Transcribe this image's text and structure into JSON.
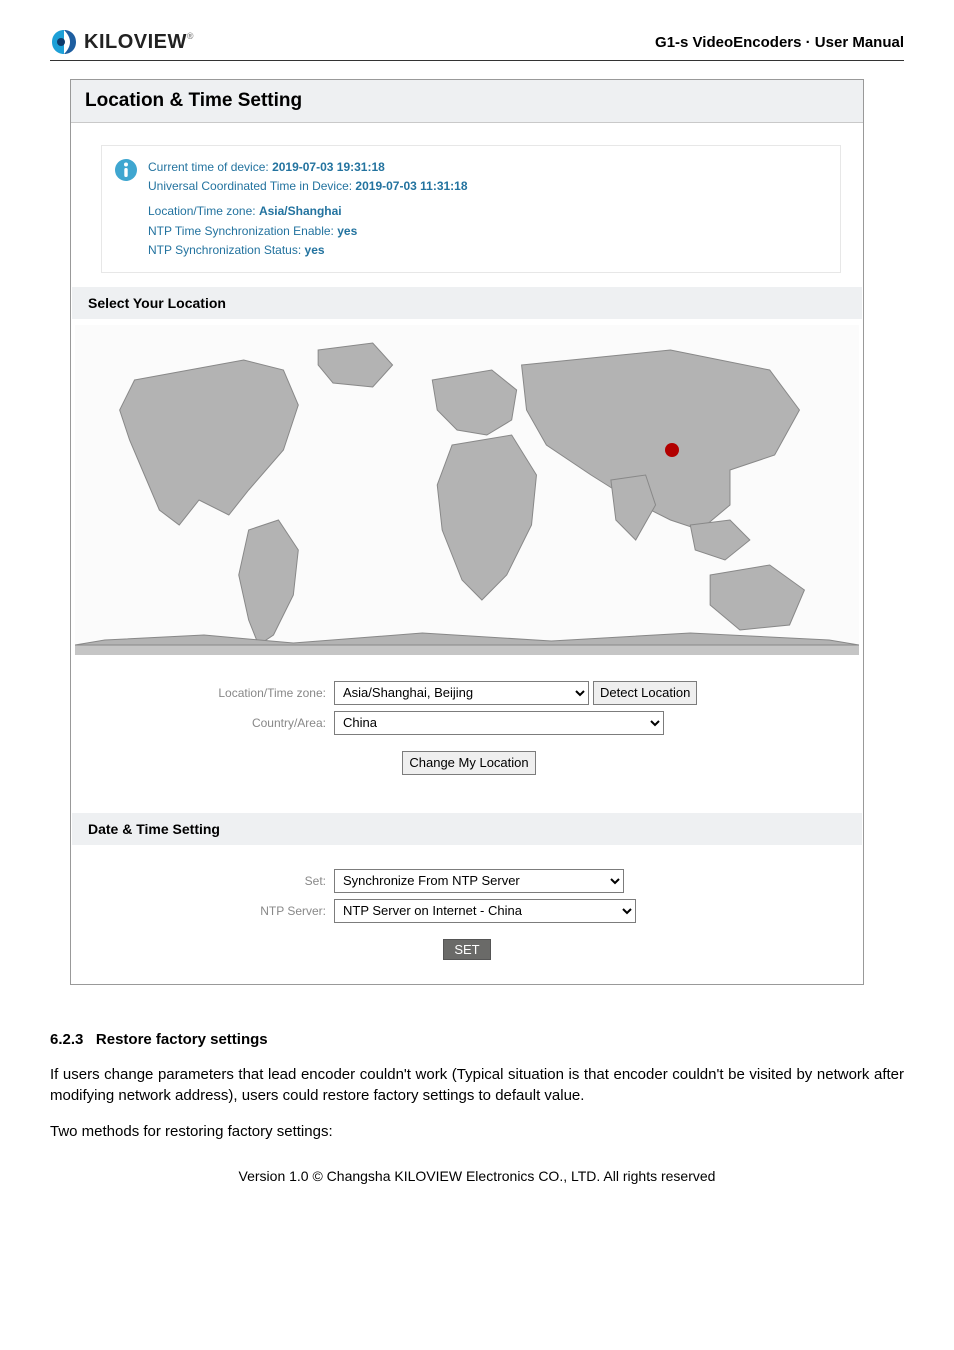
{
  "header": {
    "brand": "KILOVIEW",
    "doc_title": "G1-s VideoEncoders · User Manual"
  },
  "panel": {
    "title": "Location & Time Setting",
    "info": {
      "line1_prefix": "Current time of device: ",
      "line1_value": "2019-07-03 19:31:18",
      "line2_prefix": "Universal Coordinated Time in Device: ",
      "line2_value": "2019-07-03 11:31:18",
      "line3_prefix": "Location/Time zone: ",
      "line3_value": "Asia/Shanghai",
      "line4_prefix": "NTP Time Synchronization Enable: ",
      "line4_value": "yes",
      "line5_prefix": "NTP Synchronization Status: ",
      "line5_value": "yes"
    },
    "select_location_heading": "Select Your Location",
    "form": {
      "tz_label": "Location/Time zone:",
      "tz_value": "Asia/Shanghai, Beijing",
      "detect_btn": "Detect Location",
      "country_label": "Country/Area:",
      "country_value": "China",
      "change_btn": "Change My Location"
    },
    "dt_heading": "Date & Time Setting",
    "dt_form": {
      "set_label": "Set:",
      "set_value": "Synchronize From NTP Server",
      "ntp_label": "NTP Server:",
      "ntp_value": "NTP Server on Internet - China",
      "set_btn": "SET"
    }
  },
  "body": {
    "section_number": "6.2.3",
    "section_title": "Restore factory settings",
    "para1": "If users change parameters that lead encoder couldn't work (Typical situation is that encoder couldn't be visited by network after modifying network address), users could restore factory settings to default value.",
    "para2": "Two methods for restoring factory settings:"
  },
  "footer": "Version 1.0 © Changsha KILOVIEW Electronics CO., LTD. All rights reserved"
}
